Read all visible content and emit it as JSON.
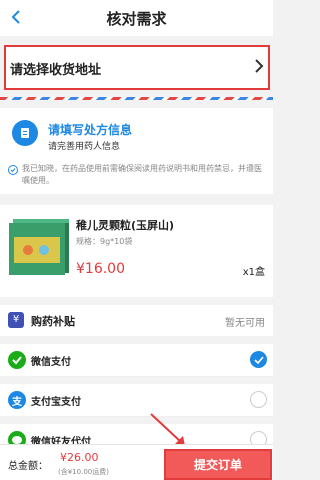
{
  "header": {
    "title": "核对需求"
  },
  "address": {
    "label": "请选择收货地址"
  },
  "prescription": {
    "title": "请填写处方信息",
    "subtitle": "请完善用药人信息",
    "notice": "我已知晓，在药品使用前需确保阅读用药说明书和用药禁忌，并遵医嘱使用。"
  },
  "product": {
    "name": "稚儿灵颗粒(玉屏山)",
    "spec": "规格：9g*10袋",
    "price": "¥16.00",
    "quantity": "x1盒"
  },
  "subsidy": {
    "label": "购药补贴",
    "status": "暂无可用"
  },
  "payment_methods": [
    {
      "label": "微信支付",
      "selected": true
    },
    {
      "label": "支付宝支付",
      "selected": false
    },
    {
      "label": "微信好友代付",
      "selected": false
    }
  ],
  "footer": {
    "total_label": "总金额：",
    "total_amount": "¥26.00",
    "shipping_note": "(含¥10.00运费)",
    "submit_label": "提交订单"
  },
  "colors": {
    "accent": "#1e88e5",
    "price": "#e23b3b",
    "submit": "#f25a5a"
  }
}
